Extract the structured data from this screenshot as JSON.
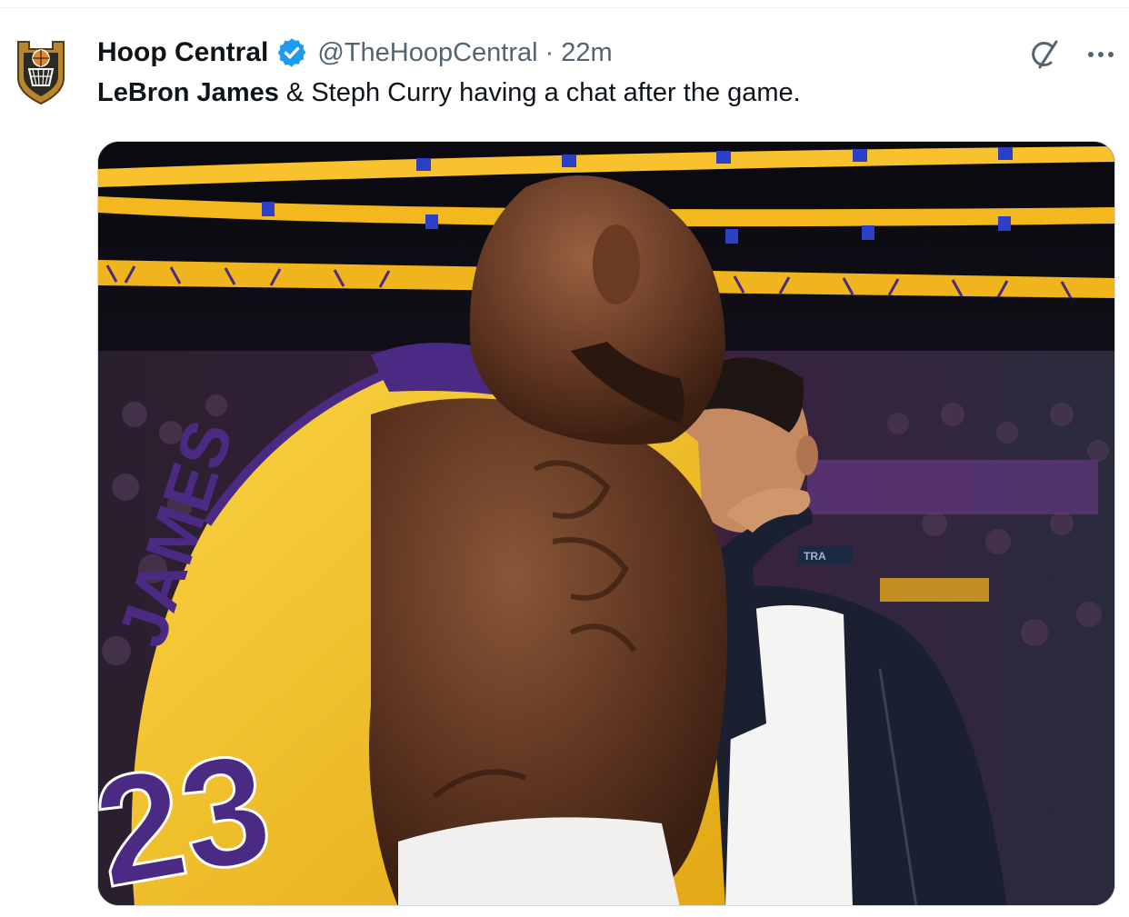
{
  "account": {
    "display_name": "Hoop Central",
    "handle": "@TheHoopCentral",
    "separator": "·",
    "timestamp": "22m",
    "avatar_icon": "hoop-central-logo-icon",
    "verified_icon": "verified-badge-icon",
    "verified_color": "#1d9bf0"
  },
  "tweet": {
    "text_bold": "LeBron James",
    "text_rest": " & Steph Curry having a chat after the game."
  },
  "actions": {
    "grok_icon": "grok-icon",
    "more_icon": "more-options-icon"
  },
  "media": {
    "type": "photo",
    "jersey_name": "JAMES",
    "jersey_number": "23",
    "courtside_text": "TRA",
    "colors": {
      "lakers_gold": "#f7c22e",
      "lakers_purple": "#4b2a84",
      "arena_dark": "#0c0a12"
    }
  }
}
